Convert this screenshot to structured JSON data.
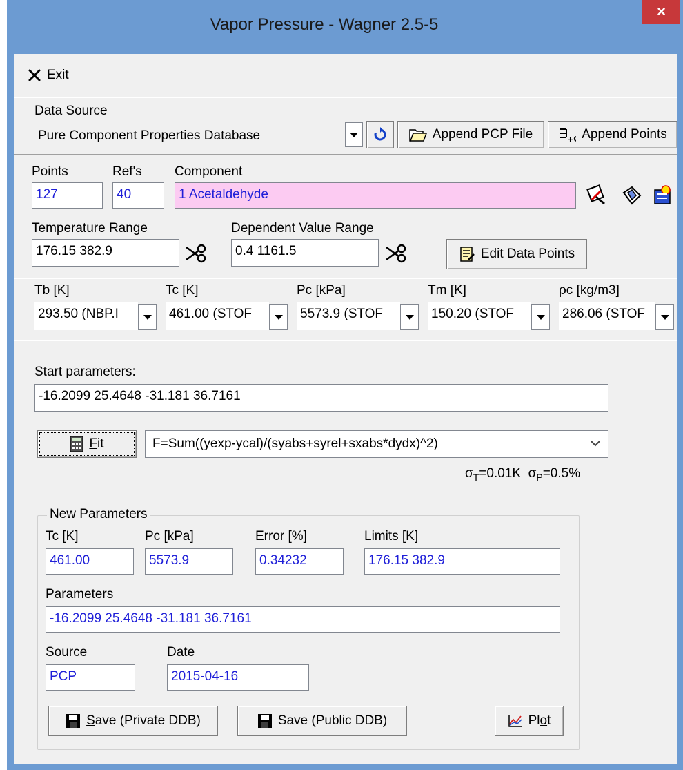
{
  "window": {
    "title": "Vapor Pressure - Wagner 2.5-5",
    "close_glyph": "×"
  },
  "toolbar": {
    "exit_label": "Exit"
  },
  "data_source": {
    "label": "Data Source",
    "value": "Pure Component Properties Database",
    "append_pcp_label": "Append PCP File",
    "append_points_label": "Append Points"
  },
  "component": {
    "points_label": "Points",
    "points_value": "127",
    "refs_label": "Ref's",
    "refs_value": "40",
    "component_label": "Component",
    "component_value": "1 Acetaldehyde",
    "temp_range_label": "Temperature Range",
    "temp_range_value": "176.15 382.9",
    "dep_range_label": "Dependent Value Range",
    "dep_range_value": "0.4 1161.5",
    "edit_points_label": "Edit Data Points"
  },
  "constants": [
    {
      "label": "Tb [K]",
      "value": "293.50 (NBP.I"
    },
    {
      "label": "Tc [K]",
      "value": "461.00 (STOF"
    },
    {
      "label": "Pc [kPa]",
      "value": "5573.9 (STOF"
    },
    {
      "label": "Tm [K]",
      "value": "150.20 (STOF"
    },
    {
      "label": "ρc [kg/m3]",
      "value": "286.06 (STOF"
    }
  ],
  "fit": {
    "start_label": "Start parameters:",
    "start_value": "-16.2099 25.4648 -31.181 36.7161",
    "fit_label_prefix": "",
    "fit_label_underlined": "F",
    "fit_label_rest": "it",
    "objective": "F=Sum((yexp-ycal)/(syabs+syrel+sxabs*dydx)^2)",
    "sigma_t": "=0.01K",
    "sigma_p": "=0.5%",
    "sigma_sym": "σ",
    "sub_t": "T",
    "sub_p": "P"
  },
  "new_params": {
    "group_label": "New Parameters",
    "tc_label": "Tc [K]",
    "tc_value": "461.00",
    "pc_label": "Pc [kPa]",
    "pc_value": "5573.9",
    "error_label": "Error [%]",
    "error_value": "0.34232",
    "limits_label": "Limits [K]",
    "limits_value": "176.15 382.9",
    "params_label": "Parameters",
    "params_value": "-16.2099 25.4648 -31.181 36.7161",
    "source_label": "Source",
    "source_value": "PCP",
    "date_label": "Date",
    "date_value": "2015-04-16",
    "save_private_u": "S",
    "save_private_rest": "ave (Private DDB)",
    "save_public_label": "Save (Public DDB)",
    "plot_prefix": "Pl",
    "plot_u": "o",
    "plot_rest": "t"
  },
  "colors": {
    "titlebar": "#6c9bd2",
    "close": "#c7383a",
    "value_text": "#1f1fd8",
    "component_bg": "#fccbf2"
  }
}
